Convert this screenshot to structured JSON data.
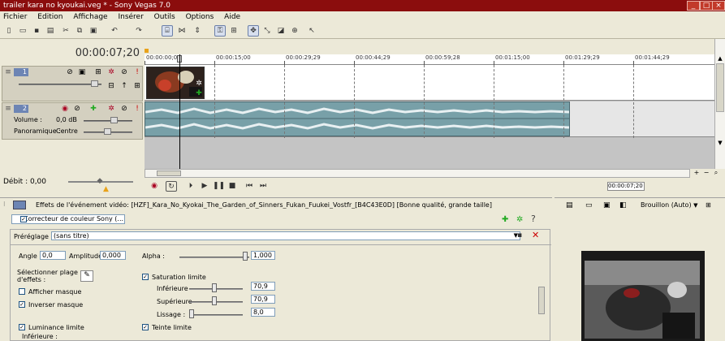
{
  "window": {
    "title": "trailer kara no kyoukai.veg * - Sony Vegas 7.0"
  },
  "menu": [
    "Fichier",
    "Edition",
    "Affichage",
    "Insérer",
    "Outils",
    "Options",
    "Aide"
  ],
  "timeline": {
    "timecode": "00:00:07;20",
    "ruler_labels": [
      "00:00:00;00",
      "00:00:15;00",
      "00:00:29;29",
      "00:00:44;29",
      "00:00:59;28",
      "00:01:15;00",
      "00:01:29;29",
      "00:01:44;29"
    ],
    "track1_number": "1",
    "track2_number": "2",
    "volume_label": "Volume :",
    "volume_value": "0,0 dB",
    "pan_label": "Panoramique :",
    "pan_value": "Centre",
    "debit": "Débit : 0,00",
    "end_timecode": "00:00:07;20"
  },
  "effects": {
    "header": "Effets de l'événement vidéo: [HZF]_Kara_No_Kyokai_The_Garden_of_Sinners_Fukan_Fuukei_Vostfr_[B4C43E0D] [Bonne qualité, grande taille]",
    "plugin_chain": "Correcteur de couleur Sony (...",
    "preset_label": "Préréglage :",
    "preset_value": "(sans titre)",
    "angle_label": "Angle :",
    "angle_value": "0,0",
    "amplitude_label": "Amplitude :",
    "amplitude_value": "0,000",
    "alpha_label": "Alpha :",
    "alpha_value": "1,000",
    "select_range_label": "Sélectionner plage d'effets :",
    "show_mask_label": "Afficher masque",
    "show_mask_checked": false,
    "invert_mask_label": "Inverser masque",
    "invert_mask_checked": true,
    "luminance_limit_label": "Luminance limite",
    "luminance_limit_checked": true,
    "lower_label": "Inférieure :",
    "saturation_limit_label": "Saturation limite",
    "saturation_limit_checked": true,
    "sat_lower_label": "Inférieure",
    "sat_lower_value": "70,9",
    "sat_upper_label": "Supérieure",
    "sat_upper_value": "70,9",
    "smoothing_label": "Lissage :",
    "smoothing_value": "8,0",
    "hue_limit_label": "Teinte limite",
    "hue_limit_checked": true
  },
  "preview": {
    "quality": "Brouillon (Auto)"
  },
  "colors": {
    "titlebar": "#8b0d0d",
    "track_number": "#6d85b4",
    "audio_wave": "#78a0a8"
  }
}
